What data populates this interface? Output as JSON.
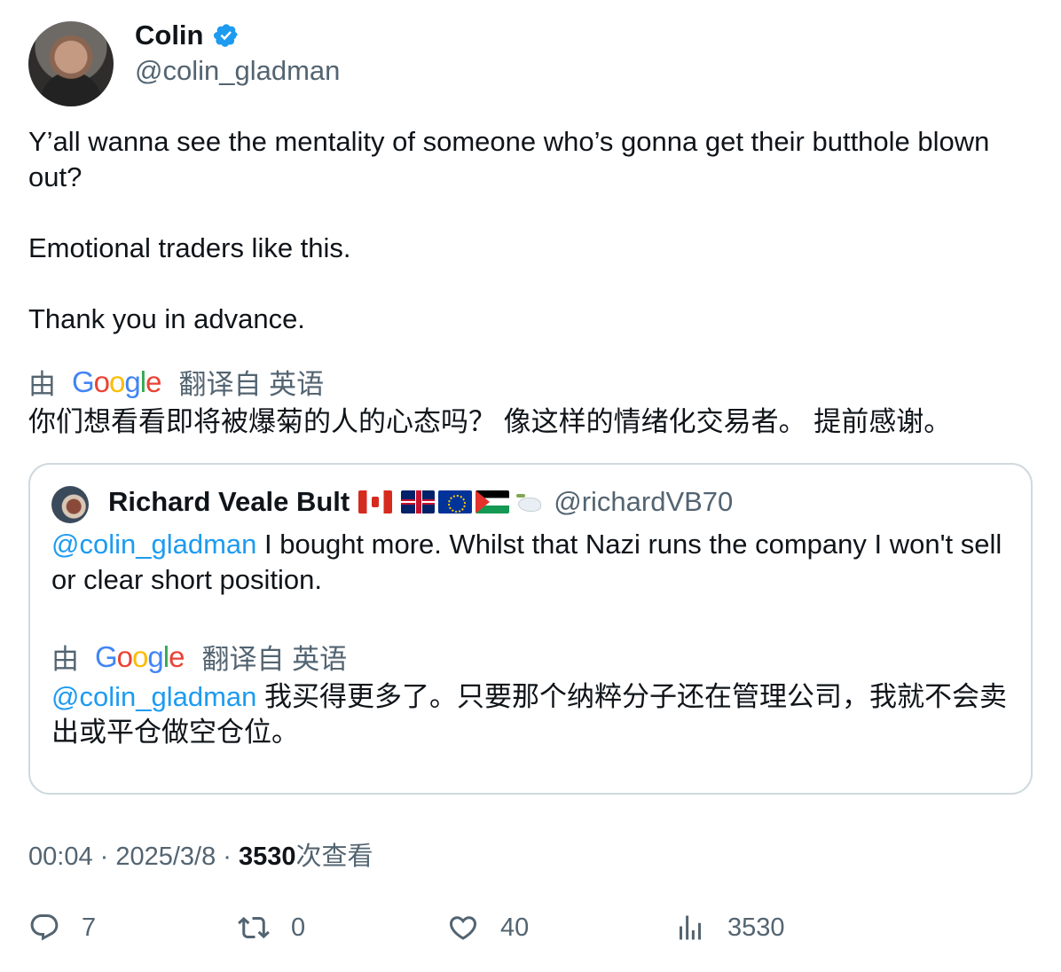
{
  "author": {
    "name": "Colin",
    "handle": "@colin_gladman",
    "verified": true
  },
  "tweet": {
    "lines": [
      "Y’all wanna see the mentality of someone who’s gonna get their butthole blown out?",
      "Emotional traders like this.",
      "Thank you in advance."
    ],
    "translated_by_prefix": "由",
    "translated_from": "翻译自 英语",
    "translation": "你们想看看即将被爆菊的人的心态吗？ 像这样的情绪化交易者。 提前感谢。"
  },
  "quoted": {
    "name": "Richard Veale Bult",
    "flags": [
      "canada-flag-icon",
      "uk-flag-icon",
      "eu-flag-icon",
      "palestine-flag-icon",
      "dove-icon"
    ],
    "handle": "@richardVB70",
    "mention": "@colin_gladman",
    "text": " I bought more. Whilst that Nazi runs the company I won't sell or clear short position.",
    "translated_by_prefix": "由",
    "translated_from": "翻译自 英语",
    "translation_mention": "@colin_gladman",
    "translation": " 我买得更多了。只要那个纳粹分子还在管理公司，我就不会卖出或平仓做空仓位。"
  },
  "meta": {
    "time": "00:04",
    "separator": " · ",
    "date": "2025/3/8",
    "views": "3530",
    "views_suffix": "次查看"
  },
  "actions": {
    "replies": "7",
    "retweets": "0",
    "likes": "40",
    "views": "3530"
  },
  "colors": {
    "accent": "#1d9bf0",
    "secondary_text": "#536471",
    "border": "#cfd9de"
  }
}
